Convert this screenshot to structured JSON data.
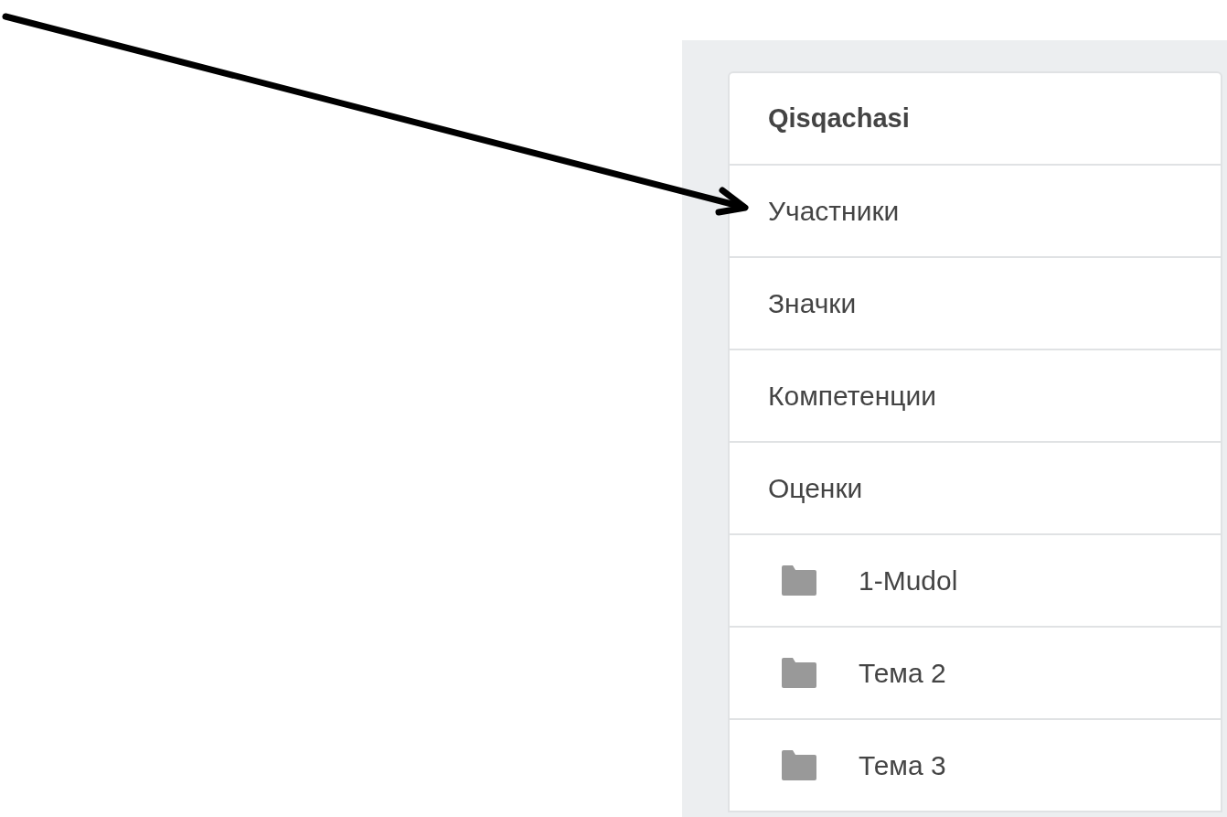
{
  "nav": {
    "items": [
      {
        "kind": "heading",
        "label": "Qisqachasi"
      },
      {
        "kind": "link",
        "label": "Участники"
      },
      {
        "kind": "link",
        "label": "Значки"
      },
      {
        "kind": "link",
        "label": "Компетенции"
      },
      {
        "kind": "link",
        "label": "Оценки"
      },
      {
        "kind": "section",
        "label": "1-Mudol"
      },
      {
        "kind": "section",
        "label": "Тема 2"
      },
      {
        "kind": "section",
        "label": "Тема 3"
      }
    ]
  }
}
